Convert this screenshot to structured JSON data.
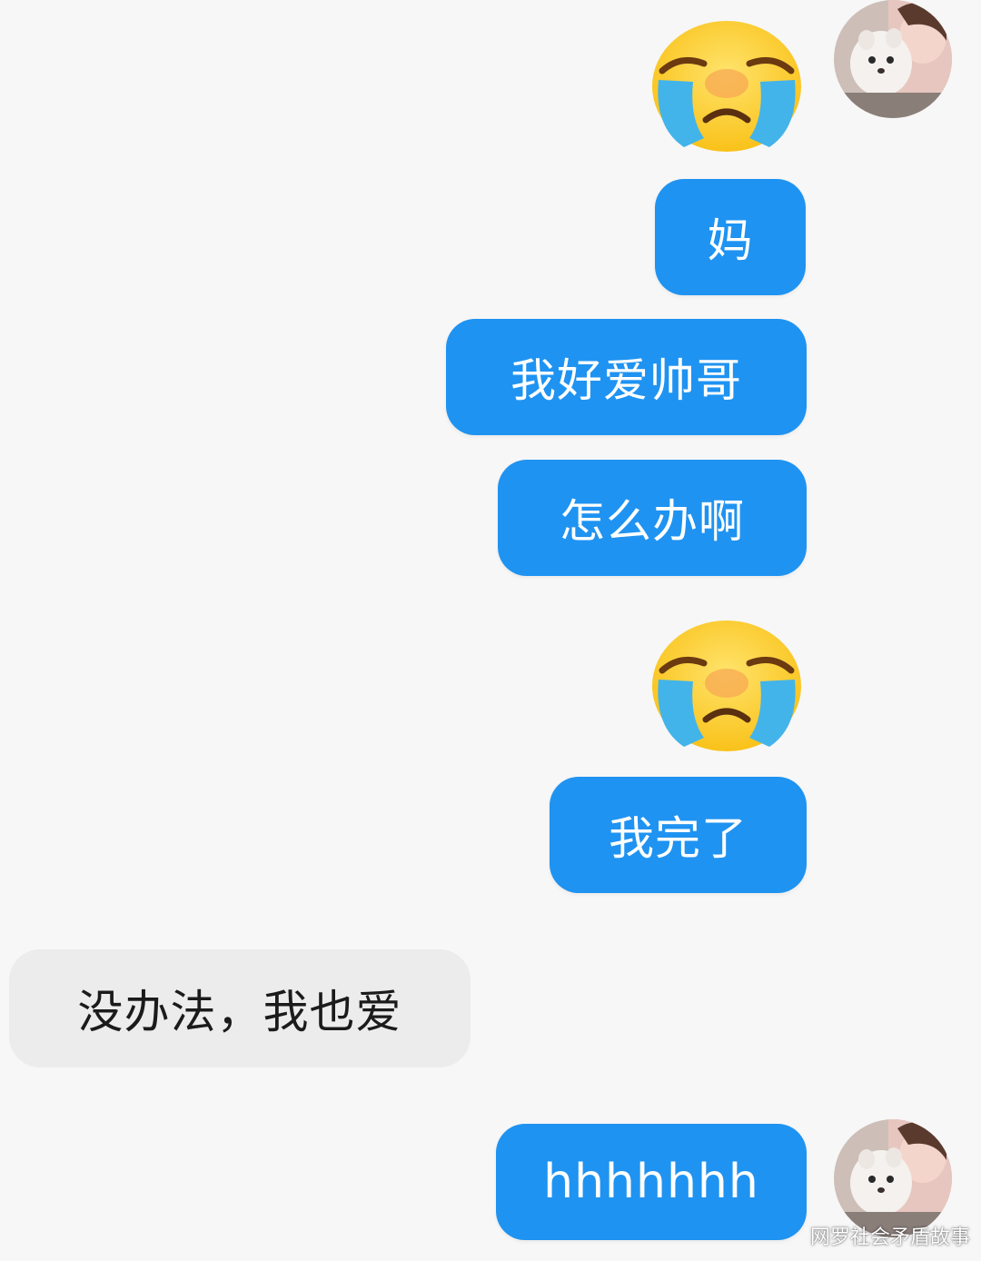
{
  "conversation": {
    "sent": {
      "emoji_1": "loudly-crying-face-emoji",
      "msg_1": "妈",
      "msg_2": "我好爱帅哥",
      "msg_3": "怎么办啊",
      "emoji_2": "loudly-crying-face-emoji",
      "msg_4": "我完了",
      "msg_5": "hhhhhhh"
    },
    "received": {
      "msg_1": "没办法，我也爱"
    }
  },
  "watermark": "网罗社会矛盾故事",
  "colors": {
    "background": "#f7f7f7",
    "sent_bubble": "#1f93f1",
    "received_bubble": "#ececec",
    "sent_text": "#ffffff",
    "received_text": "#1b1b1b"
  }
}
